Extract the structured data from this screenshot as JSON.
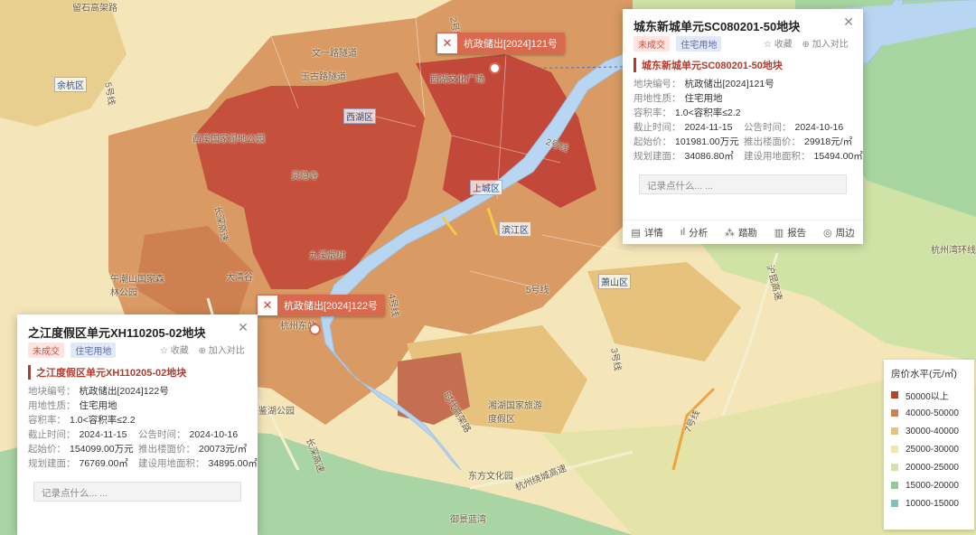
{
  "map": {
    "places": {
      "liushihe": "留石高架路",
      "wenyi": "文一路隧道",
      "yugu": "玉古路隧道",
      "xixi": "西溪国家湿地公园",
      "lingyinsi": "灵隐寺",
      "jiuxi": "九溪烟树",
      "liushiliu": "西湖文化广场",
      "wuhusz": "午潮山国家森林公园",
      "daqingyu": "大清谷",
      "xianghu": "湘湖国家旅游度假区",
      "dongfang": "东方文化园",
      "yuming": "御景蓝湾",
      "jianhu": "鉴湖公园",
      "hangzhouwan": "杭州湾环线",
      "hangshao": "杭州绕城高速",
      "changgao": "长深高速",
      "changgao2": "长深高速",
      "hugao": "沪昆高速",
      "shidai": "时代高架路",
      "xinhua": "杭州东站",
      "line5a": "5号线",
      "line5b": "5号线",
      "line2": "2号线",
      "line4": "4号线",
      "line3": "3号线",
      "line2b": "2号线",
      "line7": "7号线",
      "hangtian": "杭州南站",
      "zhijiang": "杭州乐园"
    },
    "districts": {
      "yuhang": "余杭区",
      "xihu": "西湖区",
      "shangcheng": "上城区",
      "binjiang": "滨江区",
      "xiaoshan": "萧山区"
    }
  },
  "pins": [
    {
      "label": "杭政储出[2024]121号"
    },
    {
      "label": "杭政储出[2024]122号"
    }
  ],
  "popup_right": {
    "title": "城东新城单元SC080201-50地块",
    "tags": [
      "未成交",
      "住宅用地"
    ],
    "fav": "☆ 收藏",
    "compare": "⊕ 加入对比",
    "subtitle": "城东新城单元SC080201-50地块",
    "fields": {
      "code_k": "地块编号：",
      "code_v": "杭政储出[2024]121号",
      "use_k": "用地性质：",
      "use_v": "住宅用地",
      "far_k": "容积率：",
      "far_v": "1.0<容积率≤2.2",
      "end_k": "截止时间：",
      "end_v": "2024-11-15",
      "ann_k": "公告时间：",
      "ann_v": "2024-10-16",
      "start_k": "起始价：",
      "start_v": "101981.00万元",
      "floor_k": "推出楼面价：",
      "floor_v": "29918元/㎡",
      "plan_k": "规划建面：",
      "plan_v": "34086.80㎡",
      "area_k": "建设用地面积：",
      "area_v": "15494.00㎡"
    },
    "note_placeholder": "记录点什么... ...",
    "actions": [
      "详情",
      "分析",
      "踏勘",
      "报告",
      "周边"
    ]
  },
  "popup_left": {
    "title": "之江度假区单元XH110205-02地块",
    "tags": [
      "未成交",
      "住宅用地"
    ],
    "fav": "☆ 收藏",
    "compare": "⊕ 加入对比",
    "subtitle": "之江度假区单元XH110205-02地块",
    "fields": {
      "code_k": "地块编号：",
      "code_v": "杭政储出[2024]122号",
      "use_k": "用地性质：",
      "use_v": "住宅用地",
      "far_k": "容积率：",
      "far_v": "1.0<容积率≤2.2",
      "end_k": "截止时间：",
      "end_v": "2024-11-15",
      "ann_k": "公告时间：",
      "ann_v": "2024-10-16",
      "start_k": "起始价：",
      "start_v": "154099.00万元",
      "floor_k": "推出楼面价：",
      "floor_v": "20073元/㎡",
      "plan_k": "规划建面：",
      "plan_v": "76769.00㎡",
      "area_k": "建设用地面积：",
      "area_v": "34895.00㎡"
    },
    "note_placeholder": "记录点什么... ..."
  },
  "legend": {
    "title": "房价水平(元/㎡)",
    "items": [
      {
        "label": "50000以上",
        "color": "#b5432e"
      },
      {
        "label": "40000-50000",
        "color": "#cf8050"
      },
      {
        "label": "30000-40000",
        "color": "#e6c27d"
      },
      {
        "label": "25000-30000",
        "color": "#f3e7a3"
      },
      {
        "label": "20000-25000",
        "color": "#cfe3a6"
      },
      {
        "label": "15000-20000",
        "color": "#8fc99a"
      },
      {
        "label": "10000-15000",
        "color": "#7fc3b8"
      }
    ]
  }
}
